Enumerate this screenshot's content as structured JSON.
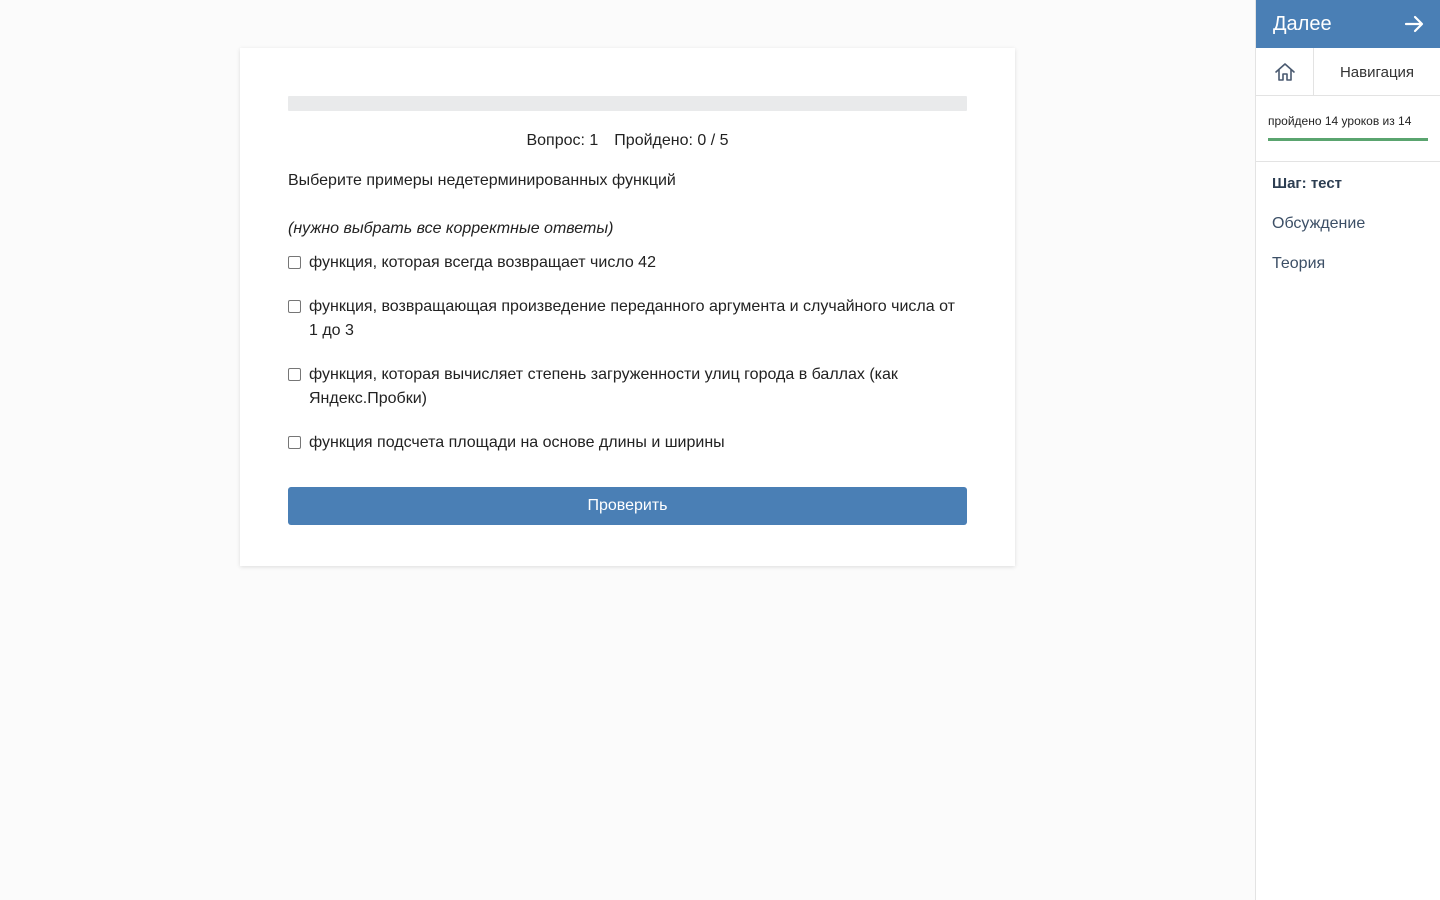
{
  "quiz": {
    "progress_fraction": 0,
    "question_label": "Вопрос: 1",
    "passed_label": "Пройдено: 0 / 5",
    "question_text": "Выберите примеры недетерминированных функций",
    "hint": "(нужно выбрать все корректные ответы)",
    "options": [
      {
        "label": "функция, которая всегда возвращает число 42",
        "checked": false
      },
      {
        "label": "функция, возвращающая произведение переданного аргумента и случайного числа от 1 до 3",
        "checked": false
      },
      {
        "label": "функция, которая вычисляет степень загруженности улиц города в баллах (как Яндекс.Пробки)",
        "checked": false
      },
      {
        "label": "функция подсчета площади на основе длины и ширины",
        "checked": false
      }
    ],
    "check_button_label": "Проверить"
  },
  "sidebar": {
    "next_label": "Далее",
    "next_icon": "arrow-right-icon",
    "home_icon": "home-icon",
    "navigation_label": "Навигация",
    "lessons_text": "пройдено 14 уроков из 14",
    "lessons_completed": 14,
    "lessons_total": 14,
    "steps": [
      {
        "label": "Шаг: тест",
        "current": true
      },
      {
        "label": "Обсуждение",
        "current": false
      },
      {
        "label": "Теория",
        "current": false
      }
    ]
  },
  "colors": {
    "accent": "#4a7fb5",
    "progress_green": "#5aa46f",
    "background": "#fbfbfb"
  }
}
